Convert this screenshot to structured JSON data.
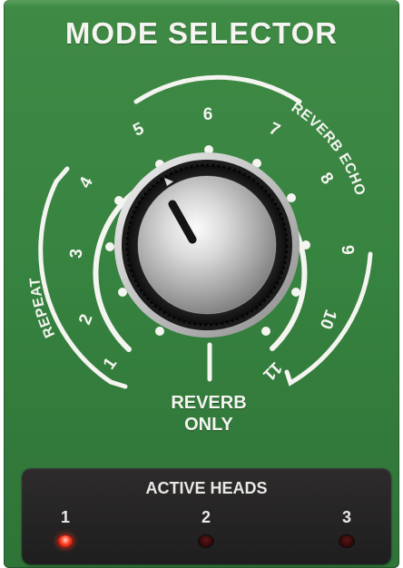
{
  "title": "MODE SELECTOR",
  "dial": {
    "positions": [
      "1",
      "2",
      "3",
      "4",
      "5",
      "6",
      "7",
      "8",
      "9",
      "10",
      "11"
    ],
    "arc_labels": {
      "repeat": "REPEAT",
      "reverb_echo": "REVERB ECHO"
    },
    "reverb_only_line1": "REVERB",
    "reverb_only_line2": "ONLY",
    "selected_position": "5"
  },
  "active_heads": {
    "title": "ACTIVE HEADS",
    "heads": [
      {
        "label": "1",
        "active": true
      },
      {
        "label": "2",
        "active": false
      },
      {
        "label": "3",
        "active": false
      }
    ]
  },
  "colors": {
    "panel": "#378340",
    "led_on": "#ff3a24",
    "led_off": "#3a0b0b"
  }
}
